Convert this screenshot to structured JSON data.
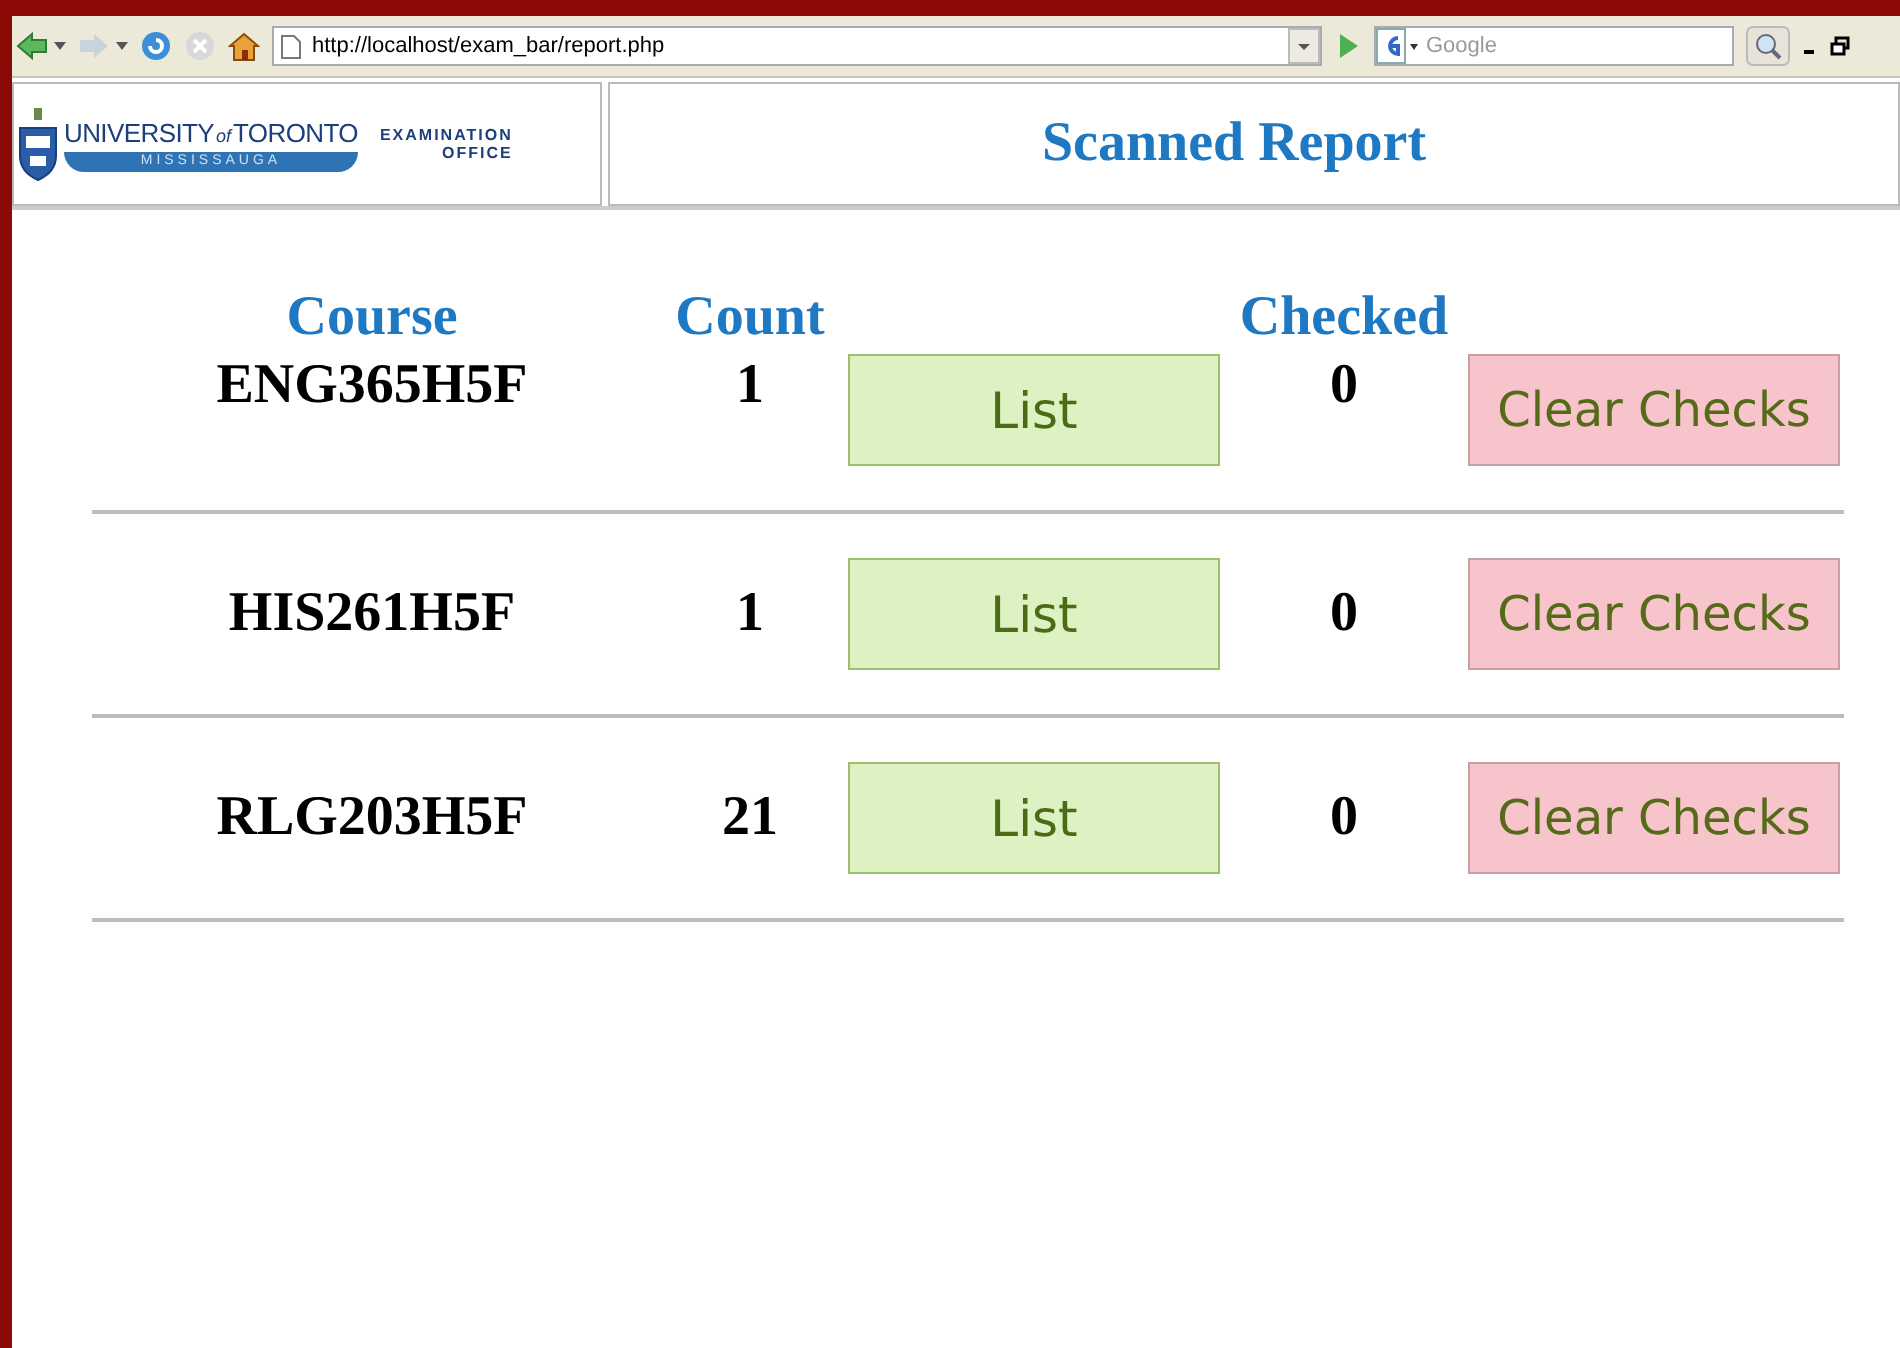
{
  "browser": {
    "url": "http://localhost/exam_bar/report.php",
    "search": {
      "placeholder": "Google"
    }
  },
  "logo": {
    "university": "UNIVERSITY",
    "of": "of",
    "toronto": "TORONTO",
    "campus": "MISSISSAUGA",
    "office_line1": "EXAMINATION",
    "office_line2": "OFFICE"
  },
  "title": "Scanned Report",
  "table": {
    "columns": [
      "Course",
      "Count",
      "Checked"
    ],
    "rows": [
      {
        "course": "ENG365H5F",
        "count": "1",
        "list_button": "List",
        "checked": "0",
        "clear_button": "Clear Checks"
      },
      {
        "course": "HIS261H5F",
        "count": "1",
        "list_button": "List",
        "checked": "0",
        "clear_button": "Clear Checks"
      },
      {
        "course": "RLG203H5F",
        "count": "21",
        "list_button": "List",
        "checked": "0",
        "clear_button": "Clear Checks"
      }
    ]
  }
}
